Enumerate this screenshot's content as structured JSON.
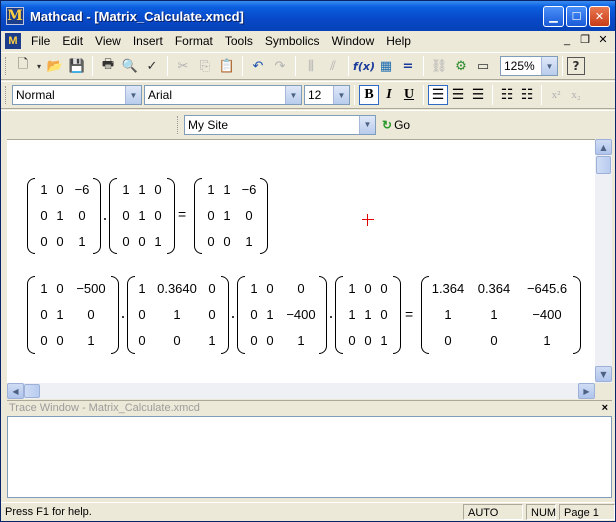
{
  "window": {
    "title": "Mathcad - [Matrix_Calculate.xmcd]"
  },
  "menu": {
    "items": [
      "File",
      "Edit",
      "View",
      "Insert",
      "Format",
      "Tools",
      "Symbolics",
      "Window",
      "Help"
    ]
  },
  "toolbar": {
    "zoom": "125%",
    "help_glyph": "?"
  },
  "format_bar": {
    "style": "Normal",
    "font": "Arial",
    "size": "12",
    "bold": "B",
    "italic": "I",
    "underline": "U",
    "superscript": "x²",
    "subscript": "x₂"
  },
  "resource_bar": {
    "site": "My Site",
    "go_label": "Go"
  },
  "worksheet": {
    "equation1": {
      "m1": [
        [
          "1",
          "0",
          "−6"
        ],
        [
          "0",
          "1",
          "0"
        ],
        [
          "0",
          "0",
          "1"
        ]
      ],
      "m2": [
        [
          "1",
          "1",
          "0"
        ],
        [
          "0",
          "1",
          "0"
        ],
        [
          "0",
          "0",
          "1"
        ]
      ],
      "result": [
        [
          "1",
          "1",
          "−6"
        ],
        [
          "0",
          "1",
          "0"
        ],
        [
          "0",
          "0",
          "1"
        ]
      ]
    },
    "equation2": {
      "m1": [
        [
          "1",
          "0",
          "−500"
        ],
        [
          "0",
          "1",
          "0"
        ],
        [
          "0",
          "0",
          "1"
        ]
      ],
      "m2": [
        [
          "1",
          "0.3640",
          "0"
        ],
        [
          "0",
          "1",
          "0"
        ],
        [
          "0",
          "0",
          "1"
        ]
      ],
      "m3": [
        [
          "1",
          "0",
          "0"
        ],
        [
          "0",
          "1",
          "−400"
        ],
        [
          "0",
          "0",
          "1"
        ]
      ],
      "m4": [
        [
          "1",
          "0",
          "0"
        ],
        [
          "1",
          "1",
          "0"
        ],
        [
          "0",
          "0",
          "1"
        ]
      ],
      "result": [
        [
          "1.364",
          "0.364",
          "−645.6"
        ],
        [
          "1",
          "1",
          "−400"
        ],
        [
          "0",
          "0",
          "1"
        ]
      ]
    },
    "equals": "="
  },
  "trace": {
    "title": "Trace Window - Matrix_Calculate.xmcd",
    "close": "×"
  },
  "status": {
    "message": "Press F1 for help.",
    "mode": "AUTO",
    "num": "NUM",
    "page": "Page 1"
  }
}
